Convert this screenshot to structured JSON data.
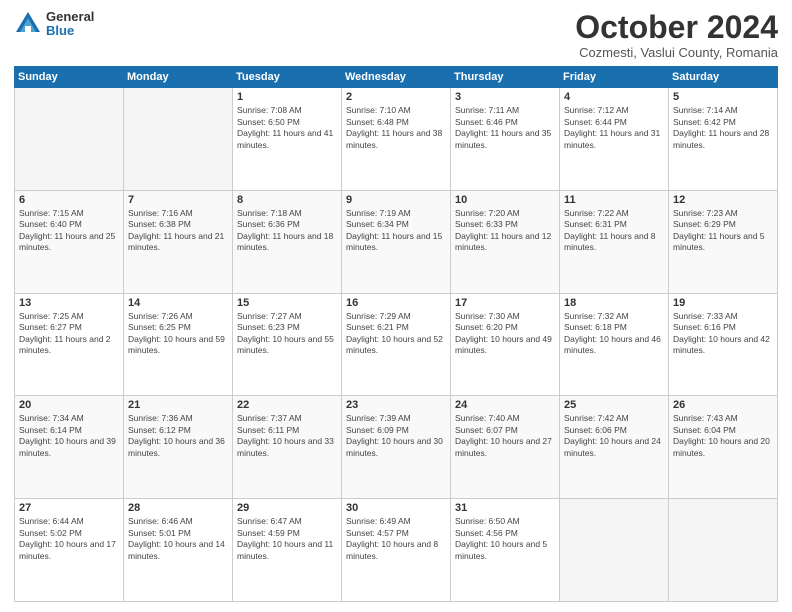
{
  "logo": {
    "general": "General",
    "blue": "Blue"
  },
  "header": {
    "month": "October 2024",
    "location": "Cozmesti, Vaslui County, Romania"
  },
  "days_of_week": [
    "Sunday",
    "Monday",
    "Tuesday",
    "Wednesday",
    "Thursday",
    "Friday",
    "Saturday"
  ],
  "weeks": [
    [
      {
        "day": "",
        "detail": ""
      },
      {
        "day": "",
        "detail": ""
      },
      {
        "day": "1",
        "detail": "Sunrise: 7:08 AM\nSunset: 6:50 PM\nDaylight: 11 hours and 41 minutes."
      },
      {
        "day": "2",
        "detail": "Sunrise: 7:10 AM\nSunset: 6:48 PM\nDaylight: 11 hours and 38 minutes."
      },
      {
        "day": "3",
        "detail": "Sunrise: 7:11 AM\nSunset: 6:46 PM\nDaylight: 11 hours and 35 minutes."
      },
      {
        "day": "4",
        "detail": "Sunrise: 7:12 AM\nSunset: 6:44 PM\nDaylight: 11 hours and 31 minutes."
      },
      {
        "day": "5",
        "detail": "Sunrise: 7:14 AM\nSunset: 6:42 PM\nDaylight: 11 hours and 28 minutes."
      }
    ],
    [
      {
        "day": "6",
        "detail": "Sunrise: 7:15 AM\nSunset: 6:40 PM\nDaylight: 11 hours and 25 minutes."
      },
      {
        "day": "7",
        "detail": "Sunrise: 7:16 AM\nSunset: 6:38 PM\nDaylight: 11 hours and 21 minutes."
      },
      {
        "day": "8",
        "detail": "Sunrise: 7:18 AM\nSunset: 6:36 PM\nDaylight: 11 hours and 18 minutes."
      },
      {
        "day": "9",
        "detail": "Sunrise: 7:19 AM\nSunset: 6:34 PM\nDaylight: 11 hours and 15 minutes."
      },
      {
        "day": "10",
        "detail": "Sunrise: 7:20 AM\nSunset: 6:33 PM\nDaylight: 11 hours and 12 minutes."
      },
      {
        "day": "11",
        "detail": "Sunrise: 7:22 AM\nSunset: 6:31 PM\nDaylight: 11 hours and 8 minutes."
      },
      {
        "day": "12",
        "detail": "Sunrise: 7:23 AM\nSunset: 6:29 PM\nDaylight: 11 hours and 5 minutes."
      }
    ],
    [
      {
        "day": "13",
        "detail": "Sunrise: 7:25 AM\nSunset: 6:27 PM\nDaylight: 11 hours and 2 minutes."
      },
      {
        "day": "14",
        "detail": "Sunrise: 7:26 AM\nSunset: 6:25 PM\nDaylight: 10 hours and 59 minutes."
      },
      {
        "day": "15",
        "detail": "Sunrise: 7:27 AM\nSunset: 6:23 PM\nDaylight: 10 hours and 55 minutes."
      },
      {
        "day": "16",
        "detail": "Sunrise: 7:29 AM\nSunset: 6:21 PM\nDaylight: 10 hours and 52 minutes."
      },
      {
        "day": "17",
        "detail": "Sunrise: 7:30 AM\nSunset: 6:20 PM\nDaylight: 10 hours and 49 minutes."
      },
      {
        "day": "18",
        "detail": "Sunrise: 7:32 AM\nSunset: 6:18 PM\nDaylight: 10 hours and 46 minutes."
      },
      {
        "day": "19",
        "detail": "Sunrise: 7:33 AM\nSunset: 6:16 PM\nDaylight: 10 hours and 42 minutes."
      }
    ],
    [
      {
        "day": "20",
        "detail": "Sunrise: 7:34 AM\nSunset: 6:14 PM\nDaylight: 10 hours and 39 minutes."
      },
      {
        "day": "21",
        "detail": "Sunrise: 7:36 AM\nSunset: 6:12 PM\nDaylight: 10 hours and 36 minutes."
      },
      {
        "day": "22",
        "detail": "Sunrise: 7:37 AM\nSunset: 6:11 PM\nDaylight: 10 hours and 33 minutes."
      },
      {
        "day": "23",
        "detail": "Sunrise: 7:39 AM\nSunset: 6:09 PM\nDaylight: 10 hours and 30 minutes."
      },
      {
        "day": "24",
        "detail": "Sunrise: 7:40 AM\nSunset: 6:07 PM\nDaylight: 10 hours and 27 minutes."
      },
      {
        "day": "25",
        "detail": "Sunrise: 7:42 AM\nSunset: 6:06 PM\nDaylight: 10 hours and 24 minutes."
      },
      {
        "day": "26",
        "detail": "Sunrise: 7:43 AM\nSunset: 6:04 PM\nDaylight: 10 hours and 20 minutes."
      }
    ],
    [
      {
        "day": "27",
        "detail": "Sunrise: 6:44 AM\nSunset: 5:02 PM\nDaylight: 10 hours and 17 minutes."
      },
      {
        "day": "28",
        "detail": "Sunrise: 6:46 AM\nSunset: 5:01 PM\nDaylight: 10 hours and 14 minutes."
      },
      {
        "day": "29",
        "detail": "Sunrise: 6:47 AM\nSunset: 4:59 PM\nDaylight: 10 hours and 11 minutes."
      },
      {
        "day": "30",
        "detail": "Sunrise: 6:49 AM\nSunset: 4:57 PM\nDaylight: 10 hours and 8 minutes."
      },
      {
        "day": "31",
        "detail": "Sunrise: 6:50 AM\nSunset: 4:56 PM\nDaylight: 10 hours and 5 minutes."
      },
      {
        "day": "",
        "detail": ""
      },
      {
        "day": "",
        "detail": ""
      }
    ]
  ]
}
